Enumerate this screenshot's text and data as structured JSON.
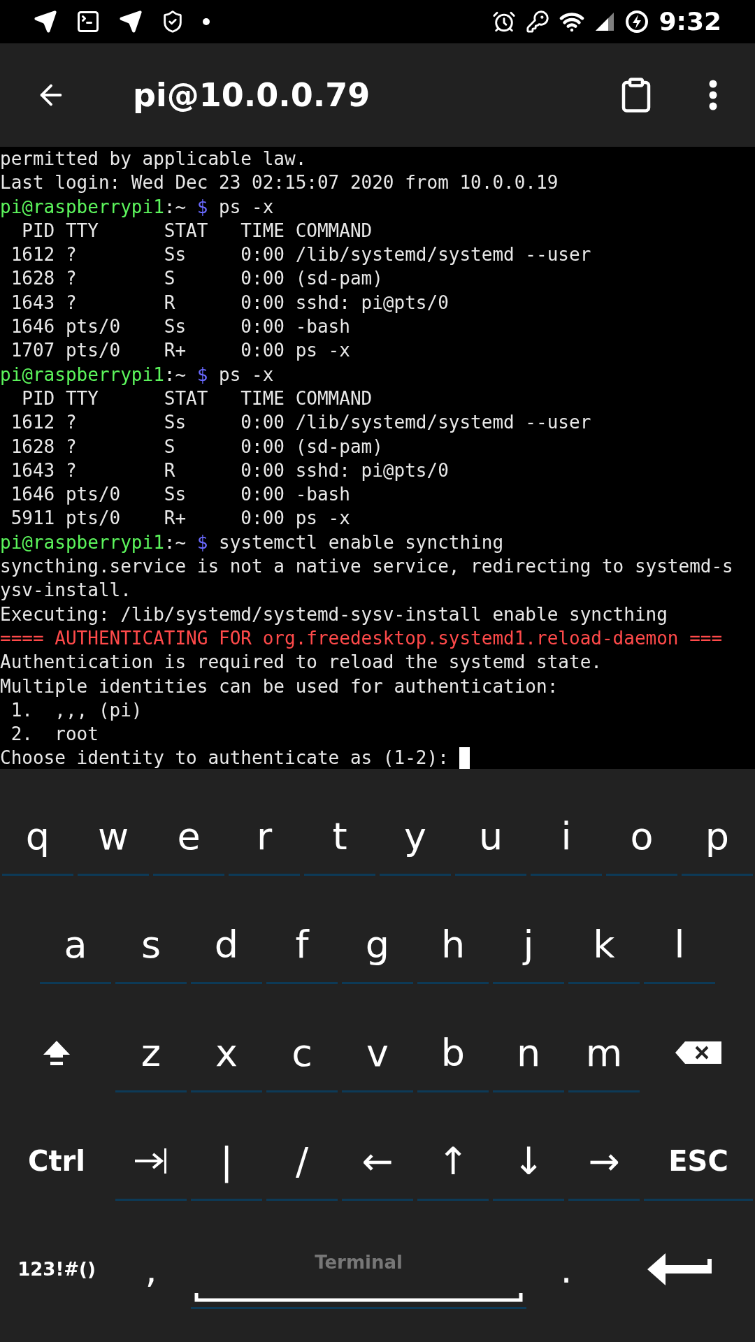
{
  "status_bar": {
    "time": "9:32"
  },
  "app_bar": {
    "title": "pi@10.0.0.79"
  },
  "terminal": {
    "lines": [
      {
        "kind": "output",
        "text": "permitted by applicable law."
      },
      {
        "kind": "output",
        "text": "Last login: Wed Dec 23 02:15:07 2020 from 10.0.0.19"
      },
      {
        "kind": "prompt",
        "user": "pi@raspberrypi1",
        "path": ":~",
        "sigil": "$",
        "command": "ps -x"
      },
      {
        "kind": "output",
        "text": "  PID TTY      STAT   TIME COMMAND"
      },
      {
        "kind": "output",
        "text": " 1612 ?        Ss     0:00 /lib/systemd/systemd --user"
      },
      {
        "kind": "output",
        "text": " 1628 ?        S      0:00 (sd-pam)"
      },
      {
        "kind": "output",
        "text": " 1643 ?        R      0:00 sshd: pi@pts/0"
      },
      {
        "kind": "output",
        "text": " 1646 pts/0    Ss     0:00 -bash"
      },
      {
        "kind": "output",
        "text": " 1707 pts/0    R+     0:00 ps -x"
      },
      {
        "kind": "prompt",
        "user": "pi@raspberrypi1",
        "path": ":~",
        "sigil": "$",
        "command": "ps -x"
      },
      {
        "kind": "output",
        "text": "  PID TTY      STAT   TIME COMMAND"
      },
      {
        "kind": "output",
        "text": " 1612 ?        Ss     0:00 /lib/systemd/systemd --user"
      },
      {
        "kind": "output",
        "text": " 1628 ?        S      0:00 (sd-pam)"
      },
      {
        "kind": "output",
        "text": " 1643 ?        R      0:00 sshd: pi@pts/0"
      },
      {
        "kind": "output",
        "text": " 1646 pts/0    Ss     0:00 -bash"
      },
      {
        "kind": "output",
        "text": " 5911 pts/0    R+     0:00 ps -x"
      },
      {
        "kind": "prompt",
        "user": "pi@raspberrypi1",
        "path": ":~",
        "sigil": "$",
        "command": "systemctl enable syncthing"
      },
      {
        "kind": "output",
        "text": "syncthing.service is not a native service, redirecting to systemd-s"
      },
      {
        "kind": "output",
        "text": "ysv-install."
      },
      {
        "kind": "output",
        "text": "Executing: /lib/systemd/systemd-sysv-install enable syncthing"
      },
      {
        "kind": "error",
        "text": "==== AUTHENTICATING FOR org.freedesktop.systemd1.reload-daemon ==="
      },
      {
        "kind": "output",
        "text": "Authentication is required to reload the systemd state."
      },
      {
        "kind": "output",
        "text": "Multiple identities can be used for authentication:"
      },
      {
        "kind": "output",
        "text": " 1.  ,,, (pi)"
      },
      {
        "kind": "output",
        "text": " 2.  root"
      },
      {
        "kind": "input",
        "text": "Choose identity to authenticate as (1-2): ",
        "cursor": true
      }
    ]
  },
  "keyboard": {
    "rows": [
      {
        "keys": [
          {
            "kind": "char",
            "label": "q",
            "underlined": true
          },
          {
            "kind": "char",
            "label": "w",
            "underlined": true
          },
          {
            "kind": "char",
            "label": "e",
            "underlined": true
          },
          {
            "kind": "char",
            "label": "r",
            "underlined": true
          },
          {
            "kind": "char",
            "label": "t",
            "underlined": true
          },
          {
            "kind": "char",
            "label": "y",
            "underlined": true
          },
          {
            "kind": "char",
            "label": "u",
            "underlined": true
          },
          {
            "kind": "char",
            "label": "i",
            "underlined": true
          },
          {
            "kind": "char",
            "label": "o",
            "underlined": true
          },
          {
            "kind": "char",
            "label": "p",
            "underlined": true
          }
        ]
      },
      {
        "keys": [
          {
            "kind": "char",
            "label": "a",
            "underlined": true
          },
          {
            "kind": "char",
            "label": "s",
            "underlined": true
          },
          {
            "kind": "char",
            "label": "d",
            "underlined": true
          },
          {
            "kind": "char",
            "label": "f",
            "underlined": true
          },
          {
            "kind": "char",
            "label": "g",
            "underlined": true
          },
          {
            "kind": "char",
            "label": "h",
            "underlined": true
          },
          {
            "kind": "char",
            "label": "j",
            "underlined": true
          },
          {
            "kind": "char",
            "label": "k",
            "underlined": true
          },
          {
            "kind": "char",
            "label": "l",
            "underlined": true
          }
        ]
      },
      {
        "keys": [
          {
            "kind": "shift",
            "underlined": false
          },
          {
            "kind": "char",
            "label": "z",
            "underlined": true
          },
          {
            "kind": "char",
            "label": "x",
            "underlined": true
          },
          {
            "kind": "char",
            "label": "c",
            "underlined": true
          },
          {
            "kind": "char",
            "label": "v",
            "underlined": true
          },
          {
            "kind": "char",
            "label": "b",
            "underlined": true
          },
          {
            "kind": "char",
            "label": "n",
            "underlined": true
          },
          {
            "kind": "char",
            "label": "m",
            "underlined": true
          },
          {
            "kind": "backspace",
            "underlined": false
          }
        ]
      },
      {
        "keys": [
          {
            "kind": "mod",
            "label": "Ctrl",
            "underlined": false
          },
          {
            "kind": "tab",
            "underlined": true
          },
          {
            "kind": "char",
            "label": "|",
            "underlined": true
          },
          {
            "kind": "char",
            "label": "/",
            "underlined": true
          },
          {
            "kind": "char",
            "label": "←",
            "underlined": true
          },
          {
            "kind": "char",
            "label": "↑",
            "underlined": true
          },
          {
            "kind": "char",
            "label": "↓",
            "underlined": true
          },
          {
            "kind": "char",
            "label": "→",
            "underlined": true
          },
          {
            "kind": "mod",
            "label": "ESC",
            "underlined": true
          }
        ]
      },
      {
        "keys": [
          {
            "kind": "small",
            "label": "123!#()",
            "underlined": false
          },
          {
            "kind": "char",
            "label": ",",
            "underlined": false
          },
          {
            "kind": "space",
            "label": "Terminal",
            "underlined": true
          },
          {
            "kind": "char",
            "label": ".",
            "underlined": false
          },
          {
            "kind": "enter",
            "underlined": false
          }
        ]
      }
    ]
  }
}
